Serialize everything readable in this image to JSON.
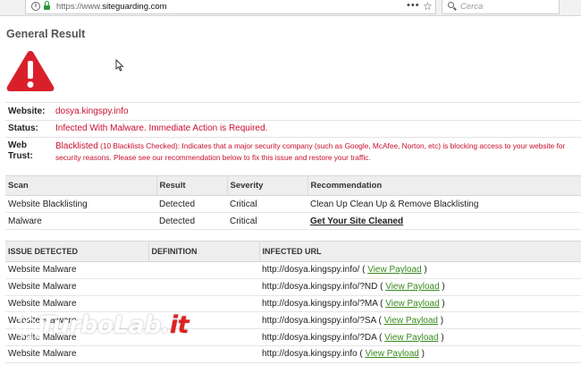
{
  "browser": {
    "url_prefix": "https://www.",
    "url_host": "siteguarding.com",
    "search_placeholder": "Cerca",
    "menu_dots": "•••",
    "star": "☆",
    "info_glyph": "i"
  },
  "page": {
    "title": "General Result"
  },
  "result": {
    "website_label": "Website:",
    "website_value": "dosya.kingspy.info",
    "status_label": "Status:",
    "status_value": "Infected With Malware. Immediate Action is Required.",
    "trust_label": "Web Trust:",
    "trust_strong": "Blacklisted",
    "trust_detail": " (10 Blacklists Checked): Indicates that a major security company (such as Google, McAfee, Norton, etc) is blocking access to your website for security reasons. Please see our recommendation below to fix this issue and restore your traffic."
  },
  "scan_table": {
    "headers": [
      "Scan",
      "Result",
      "Severity",
      "Recommendation"
    ],
    "rows": [
      [
        "Website Blacklisting",
        "Detected",
        "Critical",
        "Clean Up Clean Up & Remove Blacklisting"
      ],
      [
        "Malware",
        "Detected",
        "Critical",
        "Get Your Site Cleaned"
      ]
    ]
  },
  "issue_table": {
    "headers": [
      "ISSUE DETECTED",
      "DEFINITION",
      "INFECTED URL"
    ],
    "view_payload": "View Payload",
    "rows": [
      [
        "Website Malware",
        "",
        "http://dosya.kingspy.info/"
      ],
      [
        "Website Malware",
        "",
        "http://dosya.kingspy.info/?ND"
      ],
      [
        "Website Malware",
        "",
        "http://dosya.kingspy.info/?MA"
      ],
      [
        "Website Malware",
        "",
        "http://dosya.kingspy.info/?SA"
      ],
      [
        "Website Malware",
        "",
        "http://dosya.kingspy.info/?DA"
      ],
      [
        "Website Malware",
        "",
        "http://dosya.kingspy.info"
      ]
    ]
  },
  "watermark": {
    "text_main": "TurboLab.",
    "text_accent": "it"
  },
  "colors": {
    "danger": "#c8102e",
    "warning_triangle": "#d9202a",
    "link": "#3a8a1f"
  }
}
